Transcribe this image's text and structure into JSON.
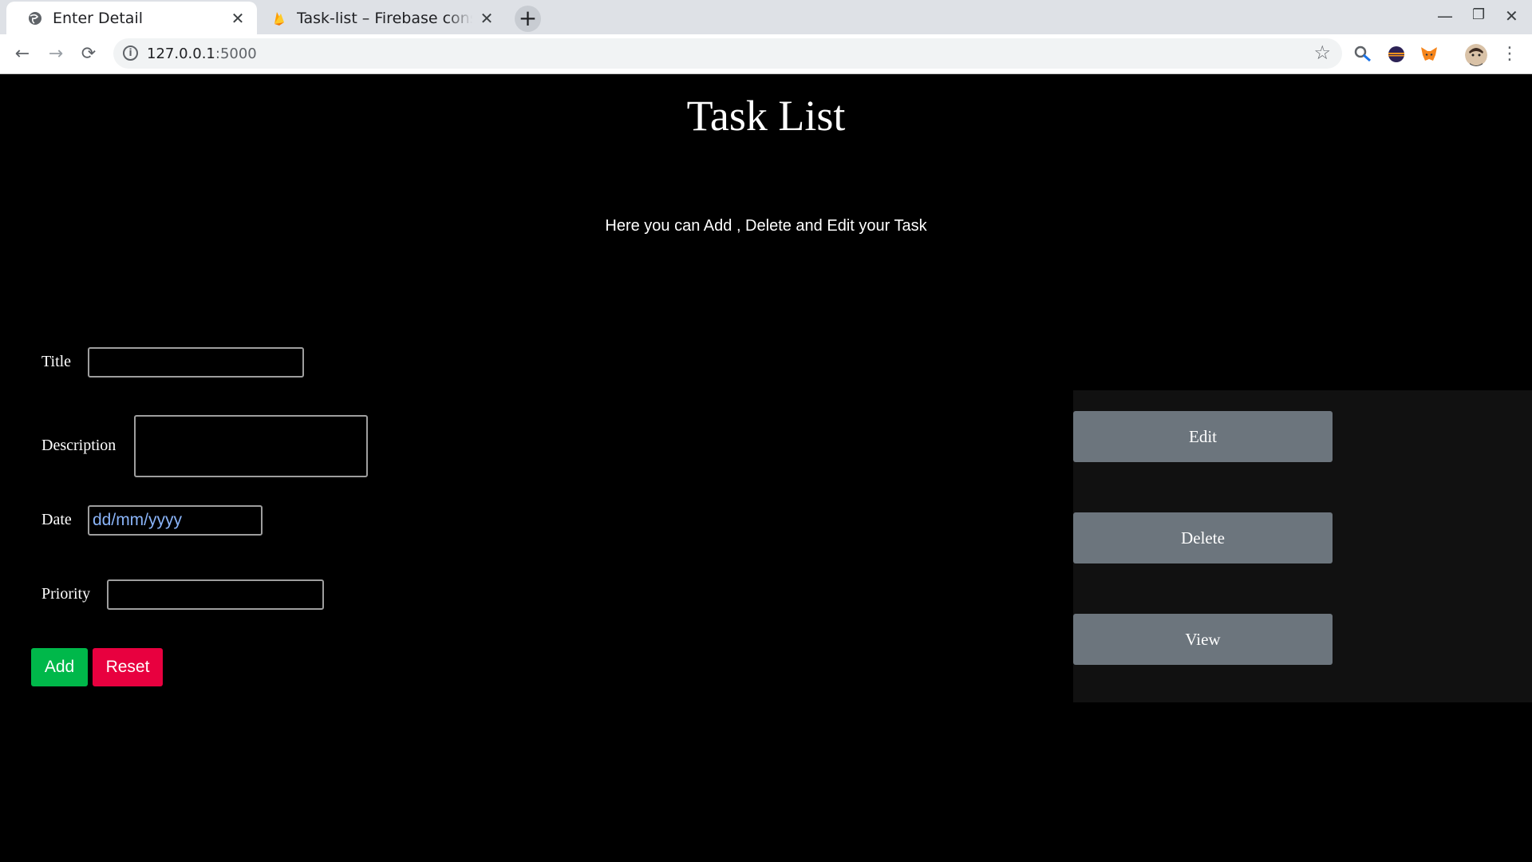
{
  "browser": {
    "tabs": [
      {
        "title": "Enter Detail",
        "active": true,
        "icon": "globe-icon"
      },
      {
        "title": "Task-list – Firebase console",
        "active": false,
        "icon": "firebase-icon"
      }
    ],
    "address": {
      "host": "127.0.0.1",
      "port": ":5000"
    },
    "extensions": [
      "magnifier-extension-icon",
      "eclipse-extension-icon",
      "metamask-fox-icon",
      "profile-avatar"
    ]
  },
  "page": {
    "title": "Task List",
    "subtitle": "Here you can Add , Delete and Edit your Task",
    "form": {
      "title_label": "Title",
      "title_value": "",
      "description_label": "Description",
      "description_value": "",
      "date_label": "Date",
      "date_placeholder": "dd/mm/yyyy",
      "priority_label": "Priority",
      "priority_value": ""
    },
    "buttons": {
      "add": "Add",
      "reset": "Reset"
    },
    "actions": {
      "edit": "Edit",
      "delete": "Delete",
      "view": "View"
    }
  },
  "colors": {
    "background": "#000000",
    "add_button": "#00b84a",
    "reset_button": "#e8003f",
    "action_button": "#6c757d",
    "panel": "#111111"
  }
}
